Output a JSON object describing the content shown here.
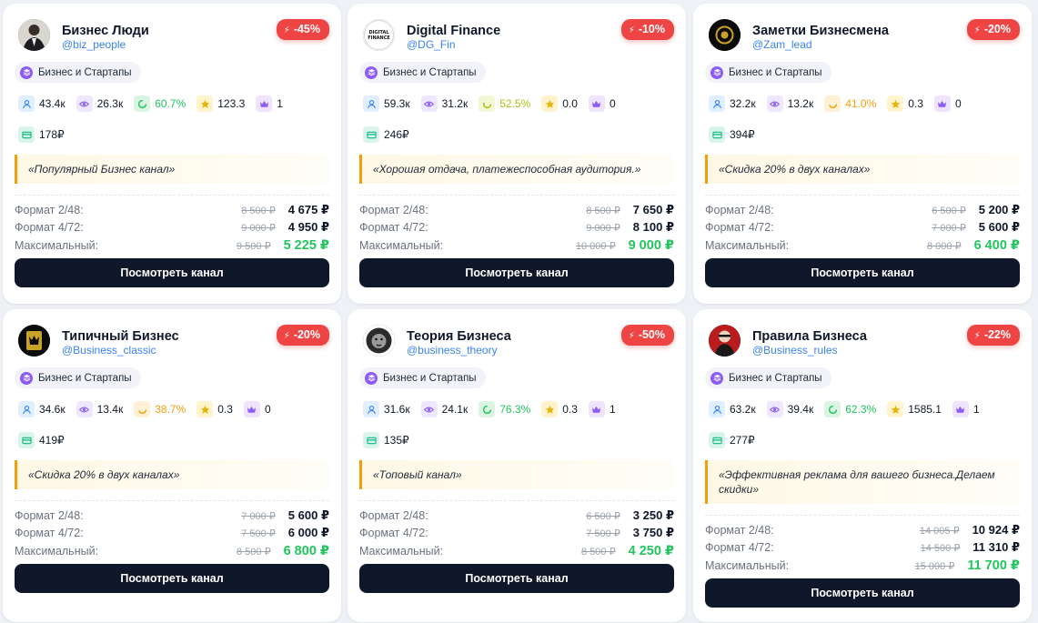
{
  "button_label": "Посмотреть канал",
  "price_labels": {
    "format1": "Формат 2/48:",
    "format2": "Формат 4/72:",
    "max": "Максимальный:"
  },
  "colors": {
    "accent_dark": "#0f172a",
    "discount_red": "#ef4444",
    "price_green": "#22c55e",
    "handle_blue": "#3b82f6",
    "quote_border": "#f59e0b"
  },
  "cards": [
    {
      "title": "Бизнес Люди",
      "handle": "@biz_people",
      "discount": "-45%",
      "category": "Бизнес и Стартапы",
      "avatar_icon": "suit-man-avatar",
      "subscribers": "43.4к",
      "views": "26.3к",
      "er": "60.7%",
      "er_color": "green",
      "rating": "123.3",
      "crown": "1",
      "cpm": "178₽",
      "quote": "«Популярный Бизнес канал»",
      "prices": {
        "format1_old": "8 500 ₽",
        "format1_new": "4 675 ₽",
        "format2_old": "9 000 ₽",
        "format2_new": "4 950 ₽",
        "max_old": "9 500 ₽",
        "max_new": "5 225 ₽"
      }
    },
    {
      "title": "Digital Finance",
      "handle": "@DG_Fin",
      "discount": "-10%",
      "category": "Бизнес и Стартапы",
      "avatar_icon": "digital-finance-logo",
      "subscribers": "59.3к",
      "views": "31.2к",
      "er": "52.5%",
      "er_color": "lime",
      "rating": "0.0",
      "crown": "0",
      "cpm": "246₽",
      "quote": "«Хорошая отдача, платежеспособная аудитория.»",
      "prices": {
        "format1_old": "8 500 ₽",
        "format1_new": "7 650 ₽",
        "format2_old": "9 000 ₽",
        "format2_new": "8 100 ₽",
        "max_old": "10 000 ₽",
        "max_new": "9 000 ₽"
      }
    },
    {
      "title": "Заметки Бизнесмена",
      "handle": "@Zam_lead",
      "discount": "-20%",
      "category": "Бизнес и Стартапы",
      "avatar_icon": "gold-emblem-avatar",
      "subscribers": "32.2к",
      "views": "13.2к",
      "er": "41.0%",
      "er_color": "yellow",
      "rating": "0.3",
      "crown": "0",
      "cpm": "394₽",
      "quote": "«Скидка 20% в двух каналах»",
      "prices": {
        "format1_old": "6 500 ₽",
        "format1_new": "5 200 ₽",
        "format2_old": "7 000 ₽",
        "format2_new": "5 600 ₽",
        "max_old": "8 000 ₽",
        "max_new": "6 400 ₽"
      }
    },
    {
      "title": "Типичный Бизнес",
      "handle": "@Business_classic",
      "discount": "-20%",
      "category": "Бизнес и Стартапы",
      "avatar_icon": "gold-crown-avatar",
      "subscribers": "34.6к",
      "views": "13.4к",
      "er": "38.7%",
      "er_color": "yellow",
      "rating": "0.3",
      "crown": "0",
      "cpm": "419₽",
      "quote": "«Скидка 20% в двух каналах»",
      "prices": {
        "format1_old": "7 000 ₽",
        "format1_new": "5 600 ₽",
        "format2_old": "7 500 ₽",
        "format2_new": "6 000 ₽",
        "max_old": "8 500 ₽",
        "max_new": "6 800 ₽"
      }
    },
    {
      "title": "Теория Бизнеса",
      "handle": "@business_theory",
      "discount": "-50%",
      "category": "Бизнес и Стартапы",
      "avatar_icon": "lion-avatar",
      "subscribers": "31.6к",
      "views": "24.1к",
      "er": "76.3%",
      "er_color": "green",
      "rating": "0.3",
      "crown": "1",
      "cpm": "135₽",
      "quote": "«Топовый канал»",
      "prices": {
        "format1_old": "6 500 ₽",
        "format1_new": "3 250 ₽",
        "format2_old": "7 500 ₽",
        "format2_new": "3 750 ₽",
        "max_old": "8 500 ₽",
        "max_new": "4 250 ₽"
      }
    },
    {
      "title": "Правила Бизнеса",
      "handle": "@Business_rules",
      "discount": "-22%",
      "category": "Бизнес и Стартапы",
      "avatar_icon": "red-portrait-avatar",
      "subscribers": "63.2к",
      "views": "39.4к",
      "er": "62.3%",
      "er_color": "green",
      "rating": "1585.1",
      "crown": "1",
      "cpm": "277₽",
      "quote": "«Эффективная реклама для вашего бизнеса.Делаем скидки»",
      "prices": {
        "format1_old": "14 005 ₽",
        "format1_new": "10 924 ₽",
        "format2_old": "14 500 ₽",
        "format2_new": "11 310 ₽",
        "max_old": "15 000 ₽",
        "max_new": "11 700 ₽"
      }
    }
  ]
}
